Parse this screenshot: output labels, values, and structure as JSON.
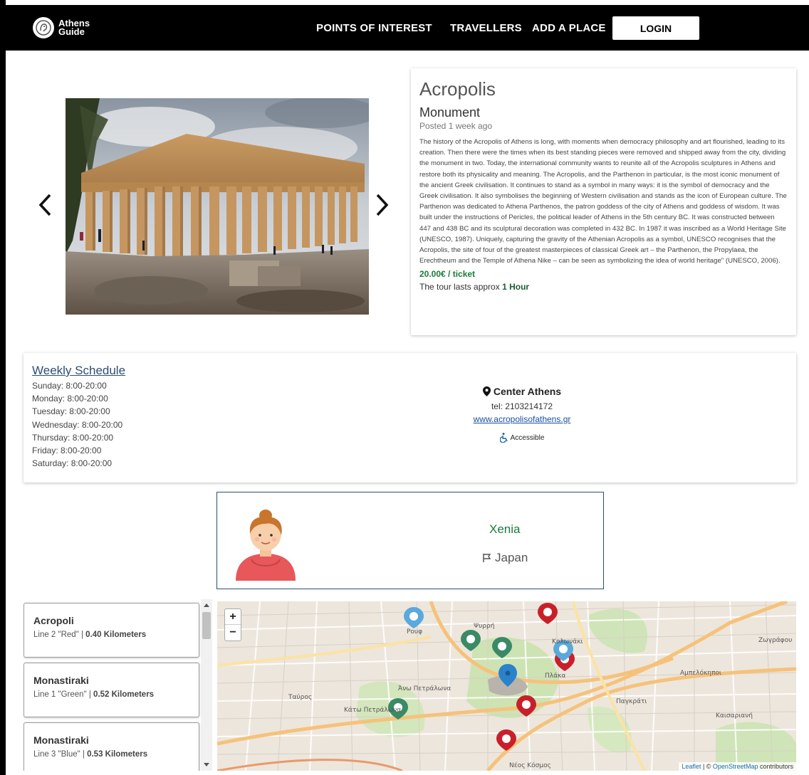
{
  "nav": {
    "logo_line1": "Athens",
    "logo_line2": "Guide",
    "points_of_interest": "POINTS OF INTEREST",
    "travellers": "TRAVELLERS",
    "add_place": "ADD A PLACE",
    "login": "LOGIN"
  },
  "place": {
    "title": "Acropolis",
    "category": "Monument",
    "posted": "Posted 1 week ago",
    "description": "The history of the Acropolis of Athens is long, with moments when democracy philosophy and art flourished, leading to its creation. Then there were the times when its best standing pieces were removed and shipped away from the city, dividing the monument in two. Today, the international community wants to reunite all of the Acropolis sculptures in Athens and restore both its physicality and meaning. The Acropolis, and the Parthenon in particular, is the most iconic monument of the ancient Greek civilisation. It continues to stand as a symbol in many ways: it is the symbol of democracy and the Greek civilisation. It also symbolises the beginning of Western civilisation and stands as the icon of European culture. The Parthenon was dedicated to Athena Parthenos, the patron goddess of the city of Athens and goddess of wisdom. It was built under the instructions of Pericles, the political leader of Athens in the 5th century BC. It was constructed between 447 and 438 BC and its sculptural decoration was completed in 432 BC. In 1987 it was inscribed as a World Heritage Site (UNESCO, 1987). Uniquely, capturing the gravity of the Athenian Acropolis as a symbol, UNESCO recognises that the Acropolis, the site of four of the greatest masterpieces of classical Greek art – the Parthenon, the Propylaea, the Erechtheum and the Temple of Athena Nike – can be seen as symbolizing the idea of world heritage\" (UNESCO, 2006).",
    "price": "20.00€ / ticket",
    "tour_prefix": "The tour lasts approx ",
    "tour_duration": "1 Hour"
  },
  "schedule": {
    "title": "Weekly Schedule",
    "days": [
      "Sunday: 8:00-20:00",
      "Monday: 8:00-20:00",
      "Tuesday: 8:00-20:00",
      "Wednesday: 8:00-20:00",
      "Thursday: 8:00-20:00",
      "Friday: 8:00-20:00",
      "Saturday: 8:00-20:00"
    ]
  },
  "contact": {
    "location": "Center Athens",
    "tel": "tel: 2103214172",
    "website": "www.acropolisofathens.gr",
    "accessible": "Accessible"
  },
  "traveller": {
    "name": "Xenia",
    "country": "Japan"
  },
  "stations": [
    {
      "name": "Acropoli",
      "line": "Line 2 \"Red\" | ",
      "distance": "0.40 Kilometers"
    },
    {
      "name": "Monastiraki",
      "line": "Line 1 \"Green\" | ",
      "distance": "0.52 Kilometers"
    },
    {
      "name": "Monastiraki",
      "line": "Line 3 \"Blue\" | ",
      "distance": "0.53 Kilometers"
    }
  ],
  "map": {
    "zoom_in": "+",
    "zoom_out": "−",
    "attribution_leaflet": "Leaflet",
    "attribution_sep": " | © ",
    "attribution_osm": "OpenStreetMap",
    "attribution_suffix": " contributors",
    "labels": [
      "Ψυρρή",
      "Κολωνάκι",
      "Πλάκα",
      "Άνω Πετράλωνα",
      "Κάτω Πετράλωνα",
      "Παγκράτι",
      "Καισαριανή",
      "Ζωγράφου",
      "Ταύρος",
      "Νέος Κόσμος",
      "Ρουφ",
      "Αμπελόκηποι"
    ]
  },
  "colors": {
    "accent_green": "#1b7a3a",
    "link_blue": "#2d4e73",
    "navbar": "#000000"
  }
}
